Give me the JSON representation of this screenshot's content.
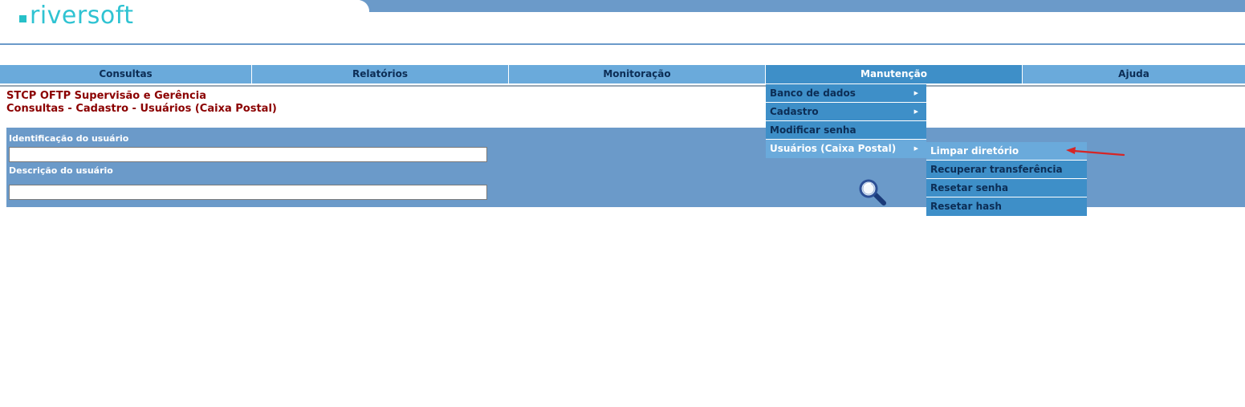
{
  "brand": {
    "logo_text": "riversoft",
    "logo_color": "#2fc3d2"
  },
  "colors": {
    "band": "#6b9ac9",
    "nav": "#6aaadb",
    "nav_active": "#3e8fc8",
    "crumb": "#8b0000",
    "annotation_arrow": "#d62525"
  },
  "nav": {
    "items": [
      {
        "label": "Consultas"
      },
      {
        "label": "Relatórios"
      },
      {
        "label": "Monitoração"
      },
      {
        "label": "Manutenção",
        "active": true
      },
      {
        "label": "Ajuda"
      }
    ]
  },
  "breadcrumb": {
    "line1": "STCP OFTP Supervisão e Gerência",
    "line2": "Consultas - Cadastro - Usuários (Caixa Postal)"
  },
  "form": {
    "user_id_label": "Identificação do usuário",
    "user_id_value": "",
    "user_desc_label": "Descrição do usuário",
    "user_desc_value": "",
    "search_icon": "magnifier-icon"
  },
  "menu_manutencao": {
    "items": [
      {
        "label": "Banco de dados",
        "has_submenu": true
      },
      {
        "label": "Cadastro",
        "has_submenu": true
      },
      {
        "label": "Modificar senha",
        "has_submenu": false
      },
      {
        "label": "Usuários (Caixa Postal)",
        "has_submenu": true,
        "open": true
      }
    ]
  },
  "submenu_usuarios": {
    "items": [
      {
        "label": "Limpar diretório",
        "highlighted": true
      },
      {
        "label": "Recuperar transferência"
      },
      {
        "label": "Resetar senha"
      },
      {
        "label": "Resetar hash"
      }
    ]
  }
}
